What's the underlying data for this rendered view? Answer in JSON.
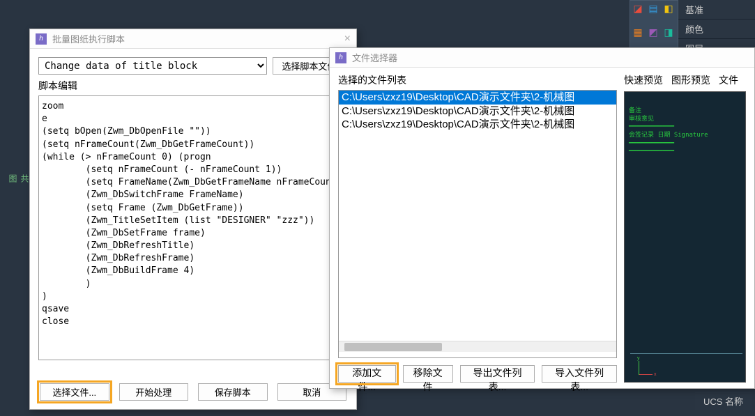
{
  "background": {
    "left_label1": "图",
    "left_label2": "共",
    "top_right_labels": [
      "基准",
      "颜色",
      "图层"
    ],
    "ucs_label": "UCS 名称"
  },
  "dialog1": {
    "title": "批量图纸执行脚本",
    "combo_value": "Change data of title block",
    "select_script_btn": "选择脚本文件.",
    "script_edit_label": "脚本编辑",
    "script_code": "zoom\ne\n(setq bOpen(Zwm_DbOpenFile \"\"))\n(setq nFrameCount(Zwm_DbGetFrameCount))\n(while (> nFrameCount 0) (progn\n        (setq nFrameCount (- nFrameCount 1))\n        (setq FrameName(Zwm_DbGetFrameName nFrameCount))\n        (Zwm_DbSwitchFrame FrameName)\n        (setq Frame (Zwm_DbGetFrame))\n        (Zwm_TitleSetItem (list \"DESIGNER\" \"zzz\"))\n        (Zwm_DbSetFrame frame)\n        (Zwm_DbRefreshTitle)\n        (Zwm_DbRefreshFrame)\n        (Zwm_DbBuildFrame 4)\n        )\n)\nqsave\nclose",
    "btn_select_file": "选择文件...",
    "btn_start": "开始处理",
    "btn_save_script": "保存脚本",
    "btn_cancel": "取消"
  },
  "dialog2": {
    "title": "文件选择器",
    "list_label": "选择的文件列表",
    "files": [
      {
        "path": "C:\\Users\\zxz19\\Desktop\\CAD演示文件夹\\2-机械图",
        "selected": true
      },
      {
        "path": "C:\\Users\\zxz19\\Desktop\\CAD演示文件夹\\2-机械图",
        "selected": false
      },
      {
        "path": "C:\\Users\\zxz19\\Desktop\\CAD演示文件夹\\2-机械图",
        "selected": false
      }
    ],
    "btn_add": "添加文件...",
    "btn_remove": "移除文件",
    "btn_export": "导出文件列表...",
    "btn_import": "导入文件列表...",
    "tabs": [
      "快速预览",
      "图形预览",
      "文件"
    ]
  }
}
